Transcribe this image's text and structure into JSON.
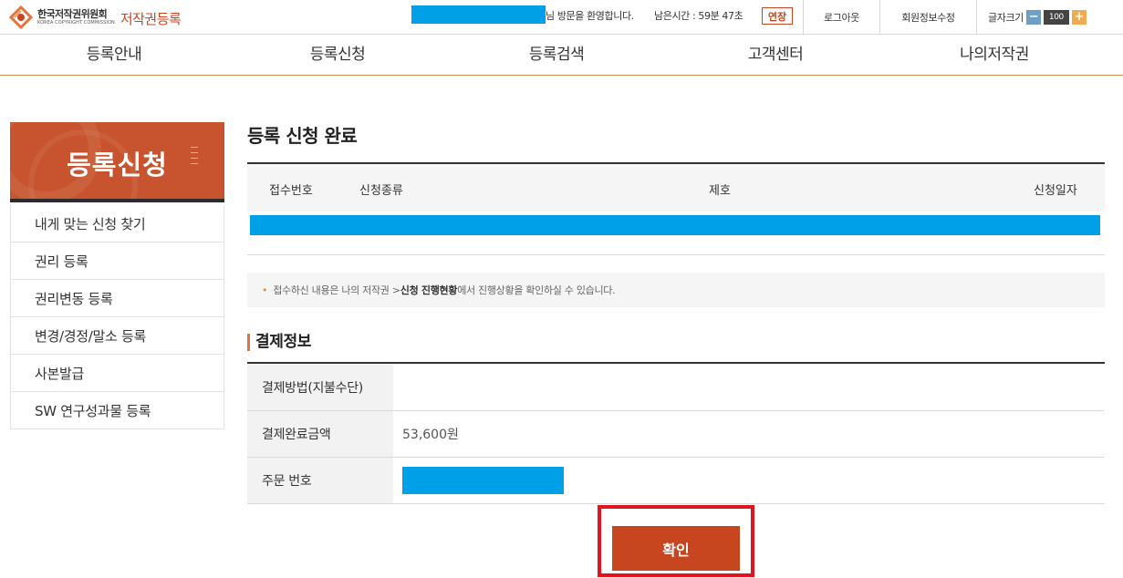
{
  "header": {
    "logo_org": "한국저작권위원회",
    "logo_org_en": "KOREA COPYRIGHT COMMISSION",
    "service_name": "저작권등록",
    "welcome_suffix": "님 방문을 환영합니다.",
    "remaining_time": "남은시간 : 59분 47초",
    "extend_label": "연장",
    "logout_label": "로그아웃",
    "member_edit_label": "회원정보수정",
    "font_size_label": "글자크기",
    "font_size_minus": "−",
    "font_size_value": "100",
    "font_size_plus": "+",
    "colors": {
      "brand": "#c8461f",
      "redacted": "#00a0e9"
    }
  },
  "gnb": {
    "items": [
      {
        "label": "등록안내"
      },
      {
        "label": "등록신청"
      },
      {
        "label": "등록검색"
      },
      {
        "label": "고객센터"
      },
      {
        "label": "나의저작권"
      }
    ]
  },
  "sidebar": {
    "title": "등록신청",
    "items": [
      {
        "label": "내게 맞는 신청 찾기"
      },
      {
        "label": "권리 등록"
      },
      {
        "label": "권리변동 등록"
      },
      {
        "label": "변경/경정/말소 등록"
      },
      {
        "label": "사본발급"
      },
      {
        "label": "SW 연구성과물 등록"
      }
    ]
  },
  "main": {
    "title": "등록 신청 완료",
    "application_table": {
      "columns": [
        "접수번호",
        "신청종류",
        "제호",
        "신청일자"
      ]
    },
    "notice": {
      "bullet": "•",
      "text_before": "접수하신 내용은 나의 저작권 > ",
      "text_bold": "신청 진행현황",
      "text_after": "에서 진행상황을 확인하실 수 있습니다."
    },
    "payment": {
      "section_title": "결제정보",
      "rows": [
        {
          "label": "결제방법(지불수단)",
          "value": ""
        },
        {
          "label": "결제완료금액",
          "value": "53,600원"
        },
        {
          "label": "주문 번호",
          "value": ""
        }
      ]
    },
    "confirm_label": "확인"
  }
}
